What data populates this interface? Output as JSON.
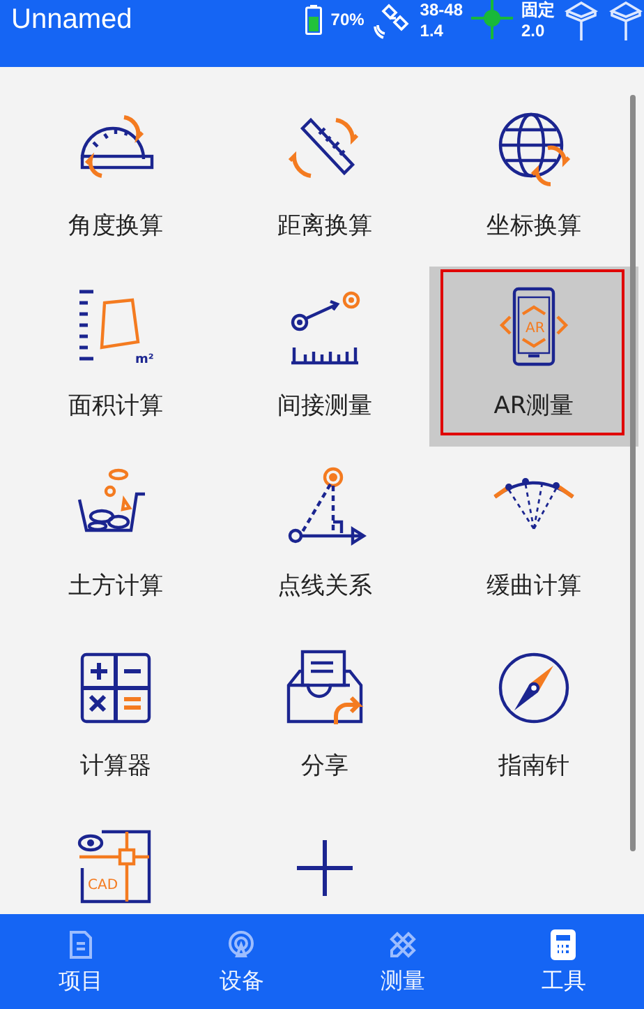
{
  "header": {
    "title": "Unnamed",
    "battery": "70%",
    "satellites": "38-48",
    "satellite_sub": "1.4",
    "fix_status": "固定",
    "fix_sub": "2.0"
  },
  "tools": [
    {
      "kind": "angle",
      "label": "角度换算",
      "selected": false
    },
    {
      "kind": "distance",
      "label": "距离换算",
      "selected": false
    },
    {
      "kind": "coordinate",
      "label": "坐标换算",
      "selected": false
    },
    {
      "kind": "area",
      "label": "面积计算",
      "icon_text": "m²",
      "selected": false
    },
    {
      "kind": "indirect",
      "label": "间接测量",
      "selected": false
    },
    {
      "kind": "ar",
      "label": "AR测量",
      "icon_text": "AR",
      "selected": true
    },
    {
      "kind": "earthwork",
      "label": "土方计算",
      "selected": false
    },
    {
      "kind": "pointline",
      "label": "点线关系",
      "selected": false
    },
    {
      "kind": "curve",
      "label": "缓曲计算",
      "selected": false
    },
    {
      "kind": "calculator",
      "label": "计算器",
      "selected": false
    },
    {
      "kind": "share",
      "label": "分享",
      "selected": false
    },
    {
      "kind": "compass",
      "label": "指南针",
      "selected": false
    },
    {
      "kind": "cad",
      "icon_text": "CAD",
      "selected": false
    },
    {
      "kind": "add",
      "selected": false
    }
  ],
  "bottom_nav": [
    {
      "kind": "project",
      "label": "项目",
      "selected": false
    },
    {
      "kind": "device",
      "label": "设备",
      "selected": false
    },
    {
      "kind": "survey",
      "label": "测量",
      "selected": false
    },
    {
      "kind": "tools",
      "label": "工具",
      "selected": true
    }
  ]
}
